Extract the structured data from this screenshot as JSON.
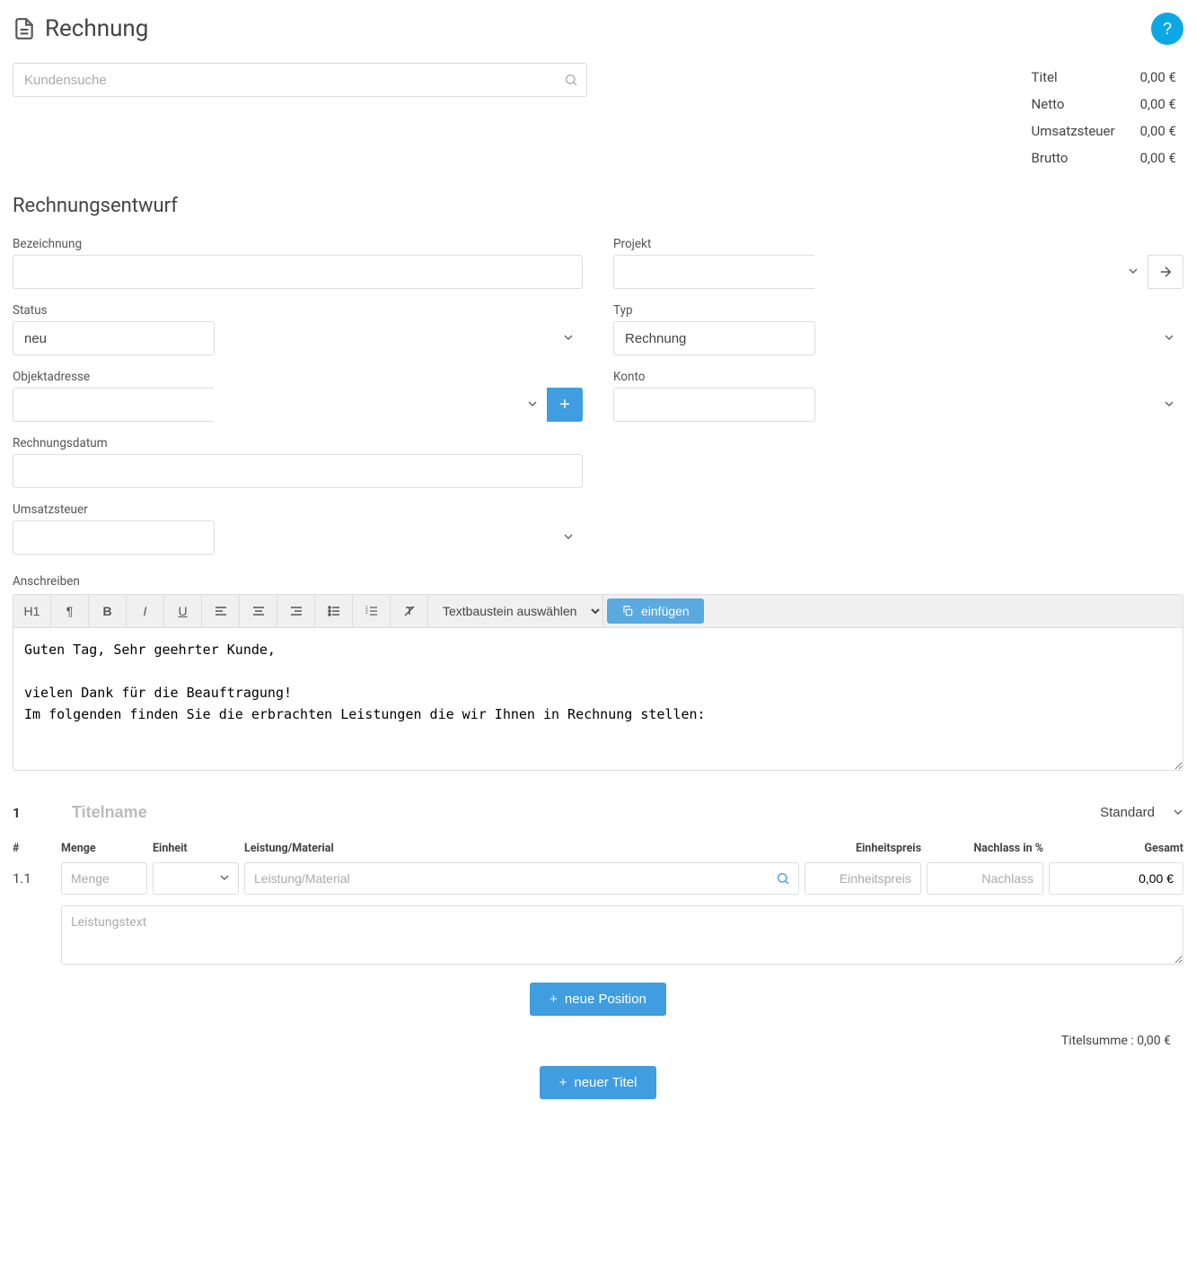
{
  "header": {
    "title": "Rechnung",
    "help_label": "?"
  },
  "search": {
    "placeholder": "Kundensuche"
  },
  "totals": {
    "rows": [
      {
        "label": "Titel",
        "value": "0,00 €"
      },
      {
        "label": "Netto",
        "value": "0,00 €"
      },
      {
        "label": "Umsatzsteuer",
        "value": "0,00 €"
      },
      {
        "label": "Brutto",
        "value": "0,00 €"
      }
    ]
  },
  "section": {
    "heading": "Rechnungsentwurf"
  },
  "form": {
    "bezeichnung": {
      "label": "Bezeichnung",
      "value": ""
    },
    "projekt": {
      "label": "Projekt",
      "value": ""
    },
    "status": {
      "label": "Status",
      "value": "neu"
    },
    "typ": {
      "label": "Typ",
      "value": "Rechnung"
    },
    "objektadresse": {
      "label": "Objektadresse",
      "value": ""
    },
    "konto": {
      "label": "Konto",
      "value": ""
    },
    "rechnungsdatum": {
      "label": "Rechnungsdatum",
      "value": ""
    },
    "umsatzsteuer": {
      "label": "Umsatzsteuer",
      "value": ""
    },
    "anschreiben": {
      "label": "Anschreiben"
    }
  },
  "toolbar": {
    "h1": "H1",
    "textblock_select": "Textbaustein auswählen",
    "insert_label": "einfügen"
  },
  "editor": {
    "content": "Guten Tag, Sehr geehrter Kunde,\n\nvielen Dank für die Beauftragung!\nIm folgenden finden Sie die erbrachten Leistungen die wir Ihnen in Rechnung stellen:"
  },
  "items": {
    "title_number": "1",
    "title_name_placeholder": "Titelname",
    "title_type": "Standard",
    "columns": {
      "num": "#",
      "menge": "Menge",
      "einheit": "Einheit",
      "leistung": "Leistung/Material",
      "einheitspreis": "Einheitspreis",
      "nachlass": "Nachlass in %",
      "gesamt": "Gesamt"
    },
    "row": {
      "number": "1.1",
      "menge_placeholder": "Menge",
      "leistung_placeholder": "Leistung/Material",
      "einheitspreis_placeholder": "Einheitspreis",
      "nachlass_placeholder": "Nachlass",
      "gesamt_value": "0,00 €",
      "text_placeholder": "Leistungstext"
    },
    "new_position_label": "neue Position",
    "titelsumme_label": "Titelsumme :",
    "titelsumme_value": "0,00 €",
    "new_title_label": "neuer Titel"
  }
}
